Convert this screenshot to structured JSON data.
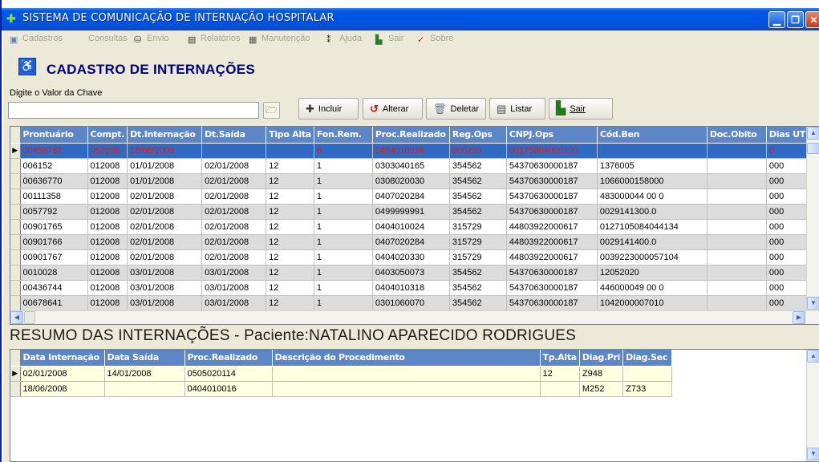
{
  "window": {
    "title": "SISTEMA DE COMUNICAÇÃO DE INTERNAÇÃO HOSPITALAR",
    "app_icon": "plus-cross-icon",
    "minimize_glyph": "▁",
    "maximize_glyph": "❐",
    "close_glyph": "✕"
  },
  "menubar": {
    "items": [
      {
        "label": "Cadastros",
        "icon": "book-icon"
      },
      {
        "label": "Consultas",
        "icon": ""
      },
      {
        "label": "Envio",
        "icon": "network-icon"
      },
      {
        "label": "Relatórios",
        "icon": "printer-icon"
      },
      {
        "label": "Manutenção",
        "icon": "tools-icon"
      },
      {
        "label": "Ajuda",
        "icon": "help-icon"
      },
      {
        "label": "Sair",
        "icon": "exit-icon"
      },
      {
        "label": "Sobre",
        "icon": "check-icon"
      }
    ]
  },
  "form": {
    "title": "CADASTRO DE INTERNAÇÕES",
    "key_label": "Digite o Valor da Chave",
    "key_value": ""
  },
  "toolbar": {
    "incluir": "Incluir",
    "alterar": "Alterar",
    "deletar": "Deletar",
    "listar": "Listar",
    "sair": "Sair"
  },
  "main_grid": {
    "columns": [
      "Prontuário",
      "Compt.",
      "Dt.Internação",
      "Dt.Saída",
      "Tipo Alta",
      "Fon.Rem.",
      "Proc.Realizado",
      "Reg.Ops",
      "CNPJ.Ops",
      "Cód.Ben",
      "Doc.Obito",
      "Dias UTI"
    ],
    "rows": [
      [
        "00458787",
        "062008",
        "18/06/2008",
        "",
        "",
        "6",
        "0404010016",
        "000239",
        "00175304000190",
        "",
        "",
        "0"
      ],
      [
        "006152",
        "012008",
        "01/01/2008",
        "02/01/2008",
        "12",
        "1",
        "0303040165",
        "354562",
        "54370630000187",
        "1376005",
        "",
        "000"
      ],
      [
        "00636770",
        "012008",
        "01/01/2008",
        "02/01/2008",
        "12",
        "1",
        "0308020030",
        "354562",
        "54370630000187",
        "1066000158000",
        "",
        "000"
      ],
      [
        "00111358",
        "012008",
        "02/01/2008",
        "02/01/2008",
        "12",
        "1",
        "0407020284",
        "354562",
        "54370630000187",
        "483000044 00 0",
        "",
        "000"
      ],
      [
        "0057792",
        "012008",
        "02/01/2008",
        "02/01/2008",
        "12",
        "1",
        "0499999991",
        "354562",
        "54370630000187",
        "0029141300.0",
        "",
        "000"
      ],
      [
        "00901765",
        "012008",
        "02/01/2008",
        "02/01/2008",
        "12",
        "1",
        "0404010024",
        "315729",
        "44803922000617",
        "0127105084044134",
        "",
        "000"
      ],
      [
        "00901766",
        "012008",
        "02/01/2008",
        "02/01/2008",
        "12",
        "1",
        "0407020284",
        "315729",
        "44803922000617",
        "0029141400.0",
        "",
        "000"
      ],
      [
        "00901767",
        "012008",
        "02/01/2008",
        "02/01/2008",
        "12",
        "1",
        "0404020330",
        "315729",
        "44803922000617",
        "0039223000057104",
        "",
        "000"
      ],
      [
        "0010028",
        "012008",
        "03/01/2008",
        "03/01/2008",
        "12",
        "1",
        "0403050073",
        "354562",
        "54370630000187",
        "12052020",
        "",
        "000"
      ],
      [
        "00436744",
        "012008",
        "03/01/2008",
        "03/01/2008",
        "12",
        "1",
        "0404010318",
        "354562",
        "54370630000187",
        "446000049 00 0",
        "",
        "000"
      ],
      [
        "00678641",
        "012008",
        "03/01/2008",
        "03/01/2008",
        "12",
        "1",
        "0301060070",
        "354562",
        "54370630000187",
        "1042000007010",
        "",
        "000"
      ]
    ]
  },
  "summary": {
    "title": "RESUMO DAS INTERNAÇÕES  - Paciente:NATALINO APARECIDO RODRIGUES",
    "columns": [
      "Data Internação",
      "Data Saída",
      "Proc.Realizado",
      "Descrição do Procedimento",
      "Tp.Alta",
      "Diag.Pri",
      "Diag.Sec"
    ],
    "rows": [
      [
        "02/01/2008",
        "14/01/2008",
        "0505020114",
        "",
        "12",
        "Z948",
        ""
      ],
      [
        "18/06/2008",
        "",
        "0404010016",
        "",
        "",
        "M252",
        "Z733"
      ]
    ]
  },
  "colors": {
    "titlebar": "#0055e5",
    "grid_header": "#5d86c7",
    "selected_row": "#316ac5",
    "selected_text": "#d21f1f",
    "summary_row": "#ffffe1",
    "form_title": "#000080"
  }
}
